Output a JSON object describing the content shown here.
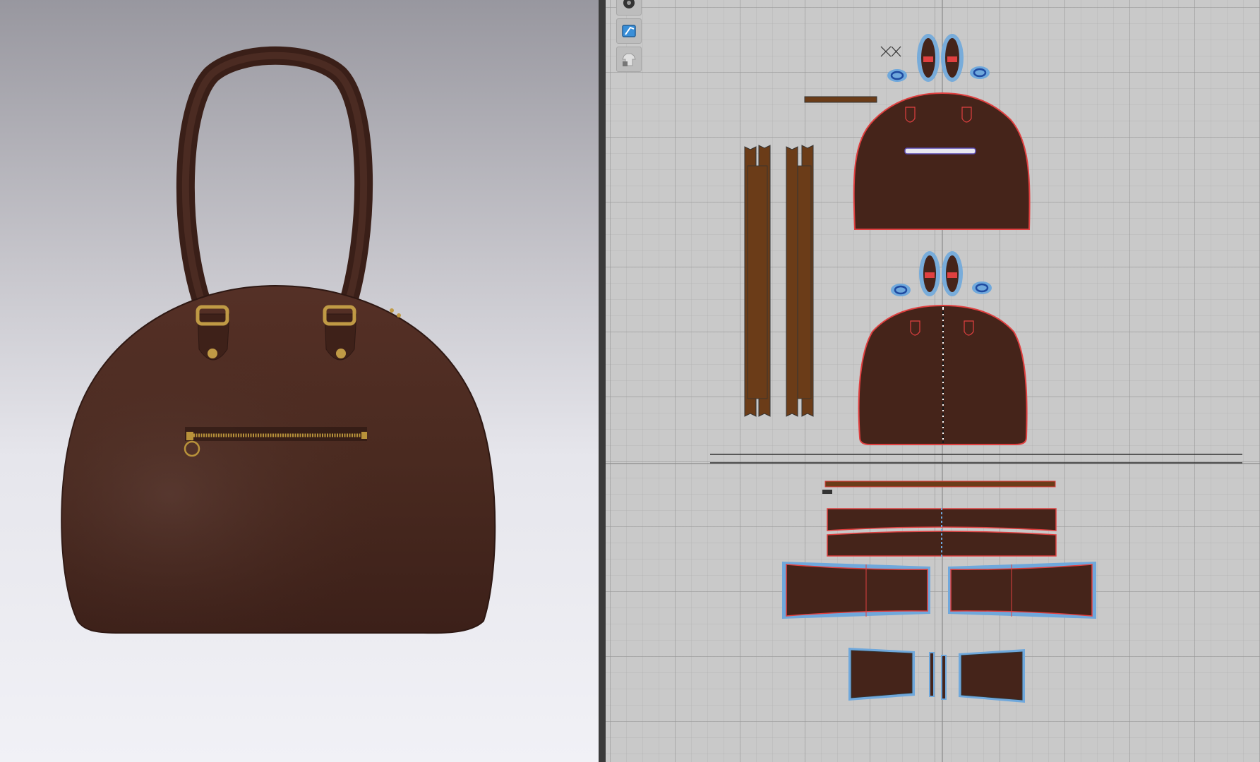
{
  "app": {
    "panels": [
      "3d-viewport",
      "2d-pattern-window"
    ]
  },
  "viewport3d": {
    "object": "handbag",
    "colors": {
      "leather": "#4a2a20",
      "leather_dark": "#3a1f18",
      "hardware": "#b8923a"
    }
  },
  "pattern2d": {
    "toolbar": [
      {
        "icon": "view-mode-icon"
      },
      {
        "icon": "show-pattern-icon"
      },
      {
        "icon": "locked-garment-icon"
      }
    ],
    "colors": {
      "piece_fill": "#45241a",
      "strap_fill": "#6b3c18",
      "seam_line": "#e04040",
      "selection": "#6fa8dc",
      "axis": "#8a8a8a"
    }
  }
}
